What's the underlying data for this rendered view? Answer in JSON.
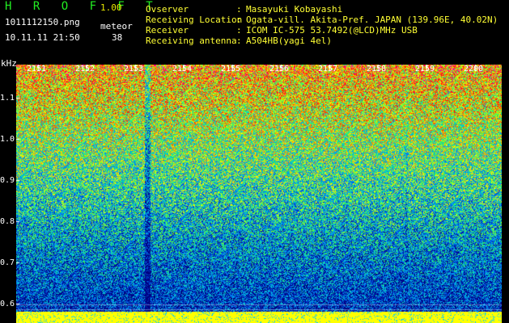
{
  "header": {
    "app_title": "H R O F F T",
    "app_version": "1.00",
    "file_name": "1011112150.png",
    "meteor_label": "meteor",
    "capture_datetime": "10.11.11 21:50",
    "meteor_count": "38"
  },
  "station_info": [
    {
      "key": "Ovserver",
      "value": "Masayuki Kobayashi"
    },
    {
      "key": "Receiving Location",
      "value": "Ogata-vill. Akita-Pref. JAPAN (139.96E, 40.02N)"
    },
    {
      "key": "Receiver",
      "value": "ICOM IC-575 53.7492(@LCD)MHz USB"
    },
    {
      "key": "Receiving antenna",
      "value": "A504HB(yagi 4el)"
    }
  ],
  "colors": {
    "title_green": "#22ee22",
    "version_yellow": "#e8e800",
    "info_yellow": "#ffff33",
    "text_white": "#ffffff",
    "background": "#000000"
  },
  "chart_data": {
    "type": "heatmap",
    "title": "",
    "xlabel": "",
    "ylabel": "kHz",
    "x": [
      "2151",
      "2152",
      "2153",
      "2154",
      "2155",
      "2156",
      "2157",
      "2158",
      "2159",
      "2200"
    ],
    "y_ticks": [
      "1.1",
      "1.0",
      "0.9",
      "0.8",
      "0.7",
      "0.6"
    ],
    "ylim": [
      0.58,
      1.18
    ],
    "colormap": [
      "#000080",
      "#0030c0",
      "#0080ff",
      "#00d0d0",
      "#40ff40",
      "#ffff00",
      "#ff8000",
      "#ff0000",
      "#ff00ff"
    ],
    "grid": true
  }
}
